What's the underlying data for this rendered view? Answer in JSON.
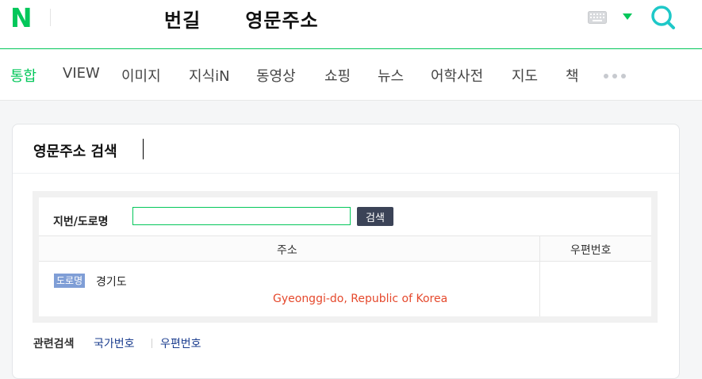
{
  "header": {
    "logo": "N",
    "query_part1": "번길",
    "query_part2": "영문주소",
    "icons": [
      "keyboard-icon",
      "dropdown-icon",
      "search-icon"
    ],
    "accent_color": "#03c75a"
  },
  "tabs": [
    {
      "label": "통합",
      "active": true
    },
    {
      "label": "VIEW"
    },
    {
      "label": "이미지"
    },
    {
      "label": "지식iN"
    },
    {
      "label": "동영상"
    },
    {
      "label": "쇼핑"
    },
    {
      "label": "뉴스"
    },
    {
      "label": "어학사전"
    },
    {
      "label": "지도"
    },
    {
      "label": "책"
    }
  ],
  "card": {
    "title": "영문주소 검색",
    "search": {
      "label": "지번/도로명",
      "value": "",
      "button_label": "검색"
    },
    "table": {
      "headers": [
        "주소",
        "우편번호"
      ],
      "rows": [
        {
          "badge": "도로명",
          "address_ko": "경기도",
          "address_en": "Gyeonggi-do, Republic of Korea",
          "postal_code": ""
        }
      ]
    },
    "related": {
      "title": "관련검색",
      "links": [
        "국가번호",
        "우편번호"
      ]
    }
  }
}
